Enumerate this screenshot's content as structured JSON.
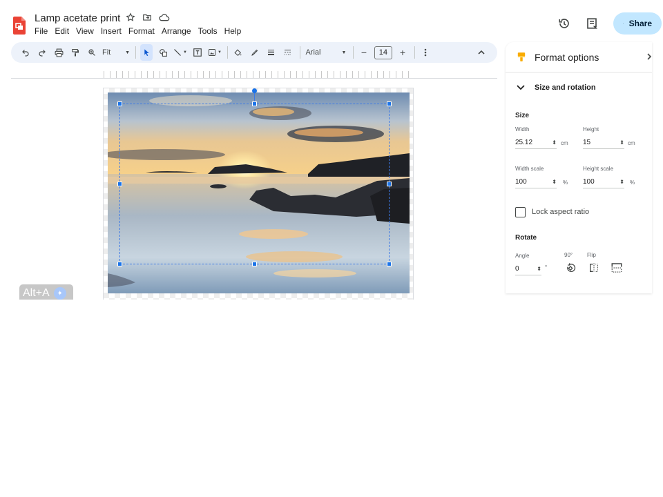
{
  "doc": {
    "title": "Lamp acetate print",
    "menu": [
      "File",
      "Edit",
      "View",
      "Insert",
      "Format",
      "Arrange",
      "Tools",
      "Help"
    ]
  },
  "header": {
    "share_label": "Share",
    "icons": [
      "history-icon",
      "comments-icon",
      "globe-icon"
    ]
  },
  "toolbar": {
    "zoom_label": "Fit",
    "font_name": "Arial",
    "font_size": "14",
    "minus": "−",
    "plus": "+"
  },
  "canvas": {
    "shortcut_hint": "Alt+A"
  },
  "panel": {
    "title": "Format options",
    "section_title": "Size and rotation",
    "size_heading": "Size",
    "width_label": "Width",
    "width_value": "25.12",
    "width_unit": "cm",
    "height_label": "Height",
    "height_value": "15",
    "height_unit": "cm",
    "width_scale_label": "Width scale",
    "width_scale_value": "100",
    "height_scale_label": "Height scale",
    "height_scale_value": "100",
    "percent_unit": "%",
    "lock_label": "Lock aspect ratio",
    "lock_checked": false,
    "rotate_heading": "Rotate",
    "angle_label": "Angle",
    "angle_value": "0",
    "degree_unit": "°",
    "rotate90_label": "90°",
    "flip_label": "Flip"
  },
  "colors": {
    "accent": "#1a73e8",
    "share_bg": "#c2e7ff",
    "toolbar_bg": "#edf2fa",
    "app_icon": "#ea4335"
  }
}
